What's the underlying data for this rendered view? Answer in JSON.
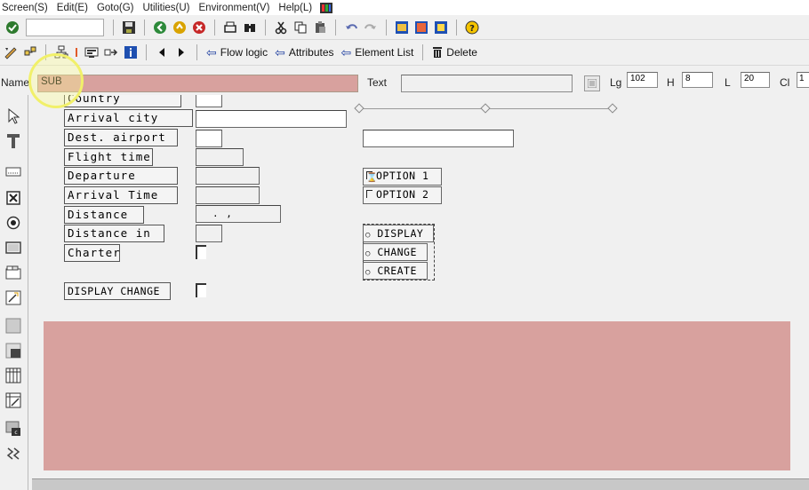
{
  "menubar": {
    "items": [
      "Screen(S)",
      "Edit(E)",
      "Goto(G)",
      "Utilities(U)",
      "Environment(V)",
      "Help(L)"
    ]
  },
  "toolbar2": {
    "flow_logic": "Flow logic",
    "attributes": "Attributes",
    "element_list": "Element List",
    "delete": "Delete"
  },
  "namerow": {
    "name_label": "Name",
    "name_value": "SUB",
    "text_label": "Text",
    "text_value": "",
    "lg_label": "Lg",
    "lg_value": "102",
    "h_label": "H",
    "h_value": "8",
    "l_label": "L",
    "l_value": "20",
    "cl_label": "Cl",
    "cl_value": "1"
  },
  "screen": {
    "labels": {
      "country": "Country",
      "arrival_city": "Arrival city",
      "dest_airport": "Dest. airport",
      "flight_time": "Flight time",
      "departure": "Departure",
      "arrival_time": "Arrival Time",
      "distance": "Distance",
      "distance_in": "Distance in",
      "charter": "Charter",
      "display_change": "DISPLAY CHANGE"
    },
    "distance_mask": ".   ,",
    "checkboxes": [
      "OPTION 1",
      "OPTION 2"
    ],
    "radios": [
      "DISPLAY",
      "CHANGE",
      "CREATE"
    ]
  },
  "colors": {
    "subscreen_area": "#d8a19e",
    "name_field": "#d8a19e",
    "highlight": "#f1f06a"
  }
}
